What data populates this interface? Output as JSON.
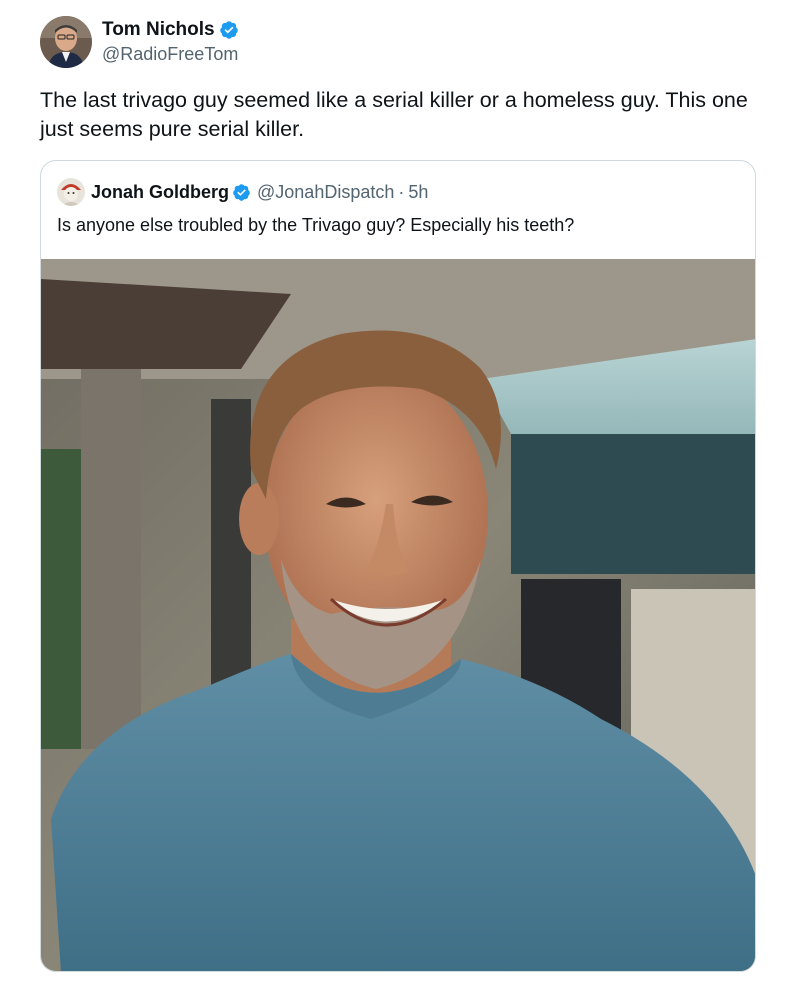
{
  "tweet": {
    "author_name": "Tom Nichols",
    "author_handle": "@RadioFreeTom",
    "text": "The last trivago guy seemed like a serial killer or a homeless guy. This one just seems pure serial killer.",
    "verified_icon": "verified-badge-icon",
    "avatar_icon": "avatar-photo"
  },
  "quoted": {
    "author_name": "Jonah Goldberg",
    "author_handle": "@JonahDispatch",
    "separator": "·",
    "time": "5h",
    "text": "Is anyone else troubled by the Trivago guy? Especially his teeth?",
    "verified_icon": "verified-badge-icon",
    "avatar_icon": "avatar-photo",
    "media_icon": "photo-man-smiling"
  },
  "colors": {
    "verified_blue": "#1d9bf0",
    "handle_gray": "#536471",
    "text": "#0f1419",
    "card_border": "#cfd9de"
  }
}
